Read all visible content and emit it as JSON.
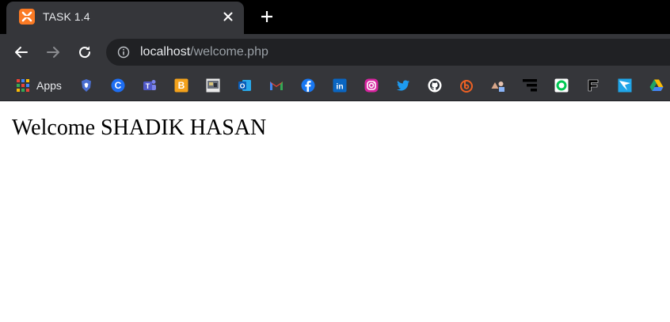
{
  "tab": {
    "title": "TASK 1.4",
    "favicon": "xampp-icon"
  },
  "address_bar": {
    "host": "localhost",
    "path": "/welcome.php"
  },
  "bookmarks": [
    {
      "label": "Apps",
      "icon": "apps-grid-icon"
    },
    {
      "label": "",
      "icon": "brave-icon"
    },
    {
      "label": "",
      "icon": "c-icon"
    },
    {
      "label": "",
      "icon": "teams-icon"
    },
    {
      "label": "",
      "icon": "blogger-icon"
    },
    {
      "label": "",
      "icon": "thumbnail-icon"
    },
    {
      "label": "",
      "icon": "outlook-icon"
    },
    {
      "label": "",
      "icon": "gmail-icon"
    },
    {
      "label": "",
      "icon": "facebook-icon"
    },
    {
      "label": "",
      "icon": "linkedin-icon"
    },
    {
      "label": "",
      "icon": "instagram-icon"
    },
    {
      "label": "",
      "icon": "twitter-icon"
    },
    {
      "label": "",
      "icon": "github-icon"
    },
    {
      "label": "",
      "icon": "bitly-icon"
    },
    {
      "label": "",
      "icon": "shapes-icon"
    },
    {
      "label": "",
      "icon": "stack-icon"
    },
    {
      "label": "",
      "icon": "green-circle-icon"
    },
    {
      "label": "",
      "icon": "flag-icon"
    },
    {
      "label": "",
      "icon": "send-icon"
    },
    {
      "label": "",
      "icon": "google-drive-icon"
    }
  ],
  "page": {
    "heading": "Welcome SHADIK HASAN"
  },
  "colors": {
    "tabstrip_bg": "#000000",
    "toolbar_bg": "#35363a",
    "omnibox_bg": "#202124",
    "xampp_orange": "#fb7a24"
  }
}
